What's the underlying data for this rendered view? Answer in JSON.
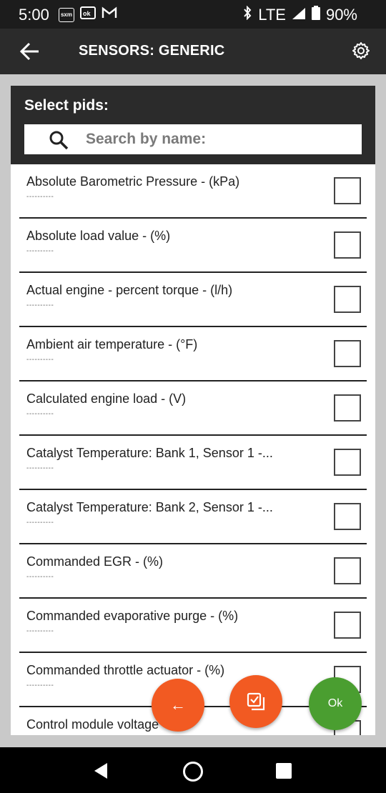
{
  "status": {
    "time": "5:00",
    "left_icons": [
      "sxm",
      "ok-icon",
      "gmail-icon"
    ],
    "network": "LTE",
    "battery": "90%"
  },
  "appbar": {
    "title": "SENSORS: GENERIC"
  },
  "dialog": {
    "title": "Select pids:",
    "search_placeholder": "Search by name:",
    "items": [
      {
        "label": "Absolute Barometric Pressure - (kPa)",
        "sub": "----------"
      },
      {
        "label": "Absolute load value - (%)",
        "sub": "----------"
      },
      {
        "label": "Actual engine - percent torque - (l/h)",
        "sub": "----------"
      },
      {
        "label": "Ambient air temperature - (°F)",
        "sub": "----------"
      },
      {
        "label": "Calculated engine load - (V)",
        "sub": "----------"
      },
      {
        "label": "Catalyst Temperature: Bank 1, Sensor 1 -...",
        "sub": "----------"
      },
      {
        "label": "Catalyst Temperature: Bank 2, Sensor 1 -...",
        "sub": "----------"
      },
      {
        "label": "Commanded EGR - (%)",
        "sub": "----------"
      },
      {
        "label": "Commanded evaporative purge - (%)",
        "sub": "----------"
      },
      {
        "label": "Commanded throttle actuator - (%)",
        "sub": "----------"
      },
      {
        "label": "Control module voltage",
        "sub": ""
      }
    ]
  },
  "fabs": {
    "back_label": "←",
    "ok_label": "Ok"
  }
}
